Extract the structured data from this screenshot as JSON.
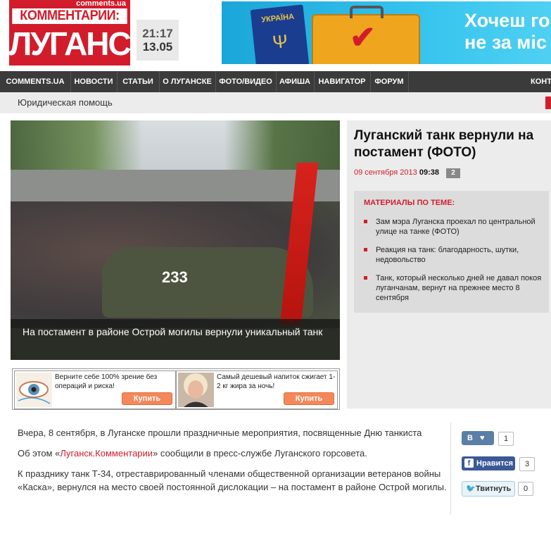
{
  "header": {
    "logo_small": "comments.ua",
    "logo_top": "КОММЕНТАРИИ:",
    "logo_main": "ЛУГАНСК",
    "time": "21:17",
    "date": "13.05",
    "banner_text_1": "Хочеш го",
    "banner_text_2": "не за міс",
    "passport_text": "УКРАЇНА"
  },
  "nav": {
    "items": [
      "comments.ua",
      "Новости",
      "Статьи",
      "О Луганске",
      "Фото/видео",
      "Афиша",
      "Навигатор",
      "Форум",
      "Конта"
    ]
  },
  "subnav": {
    "link": "Юридическая помощь"
  },
  "photo": {
    "tank_number": "233",
    "caption": "На постамент в районе Острой могилы вернули уникальный танк"
  },
  "article_head": {
    "title": "Луганский танк вернули на постамент (ФОТО)",
    "date": "09 сентября 2013",
    "time": "09:38",
    "comments": "2"
  },
  "related": {
    "title": "Материалы по теме:",
    "items": [
      "Зам мэра Луганска проехал по центральной улице на танке (ФОТО)",
      "Реакция на танк: благодарность, шутки, недовольство",
      "Танк, который несколько дней не давал покоя луганчанам, вернут на прежнее место 8 сентября"
    ]
  },
  "ads": [
    {
      "text": "Верните себе 100% зрение без операций и риска!",
      "button": "Купить",
      "icon": "eye-image"
    },
    {
      "text": "Самый дешевый напиток сжигает 1-2 кг жира за ночь!",
      "button": "Купить",
      "icon": "woman-portrait-image"
    }
  ],
  "article": {
    "p1": "Вчера, 8 сентября, в Луганске прошли праздничные мероприятия,  посвященные Дню танкиста",
    "p2_before": "Об этом «",
    "p2_link": "Луганск.Комментарии",
    "p2_after": "» сообщили в пресс-службе Луганского горсовета.",
    "p3": "К празднику танк Т-34, отреставрированный членами общественной организации ветеранов войны «Каска», вернулся на место своей постоянной дислокации – на постамент в районе Острой могилы."
  },
  "social": {
    "vk_label": "В",
    "vk_count": "1",
    "fb_label": "Нравится",
    "fb_count": "3",
    "tw_label": "Твитнуть",
    "tw_count": "0"
  },
  "colors": {
    "brand_red": "#d21c2b",
    "nav_bg": "#3b3b3b",
    "panel_bg": "#ececec"
  }
}
